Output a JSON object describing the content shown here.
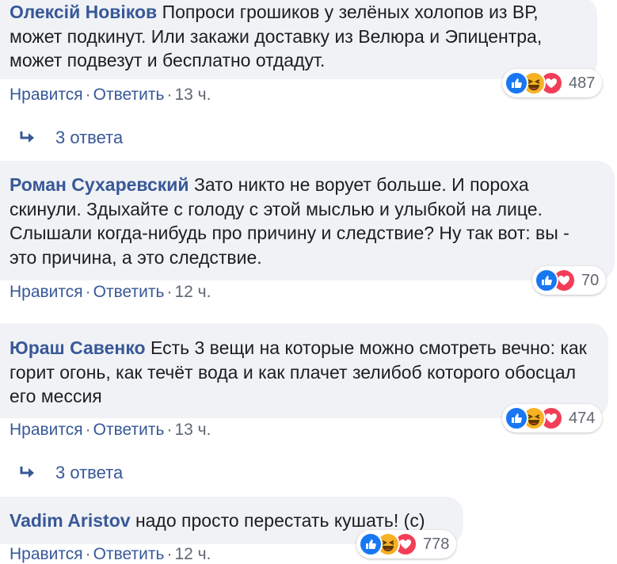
{
  "comments": [
    {
      "author": "Олексій Новіков",
      "text": "Попроси грошиков у зелёных холопов из ВР, может подкинут. Или закажи доставку из Велюра и Эпицентра, может подвезут и бесплатно отдадут.",
      "like": "Нравится",
      "reply": "Ответить",
      "time": "13 ч.",
      "reactions": [
        "like",
        "haha",
        "love"
      ],
      "reaction_count": "487",
      "replies_label": "3 ответа"
    },
    {
      "author": "Роман Сухаревский",
      "text": "Зато никто не ворует больше. И пороха скинули. Здыхайте с голоду с этой мыслью и улыбкой на лице. Слышали когда-нибудь про причину и следствие? Ну так вот: вы - это причина, а это следствие.",
      "like": "Нравится",
      "reply": "Ответить",
      "time": "12 ч.",
      "reactions": [
        "like",
        "love"
      ],
      "reaction_count": "70"
    },
    {
      "author": "Юраш Савенко",
      "text": "Есть 3 вещи на которые можно смотреть вечно: как горит огонь, как течёт вода и как плачет зелибоб которого обосцал его мессия",
      "like": "Нравится",
      "reply": "Ответить",
      "time": "13 ч.",
      "reactions": [
        "like",
        "haha",
        "love"
      ],
      "reaction_count": "474",
      "replies_label": "3 ответа"
    },
    {
      "author": "Vadim Aristov",
      "text": "надо просто перестать кушать! (с)",
      "like": "Нравится",
      "reply": "Ответить",
      "time": "12 ч.",
      "reactions": [
        "like",
        "haha",
        "love"
      ],
      "reaction_count": "778"
    }
  ],
  "colors": {
    "author": "#385898",
    "bubble": "#f0f2f5",
    "like_reaction": "#1877f2",
    "haha_reaction": "#f7b125",
    "love_reaction": "#f33e58"
  }
}
